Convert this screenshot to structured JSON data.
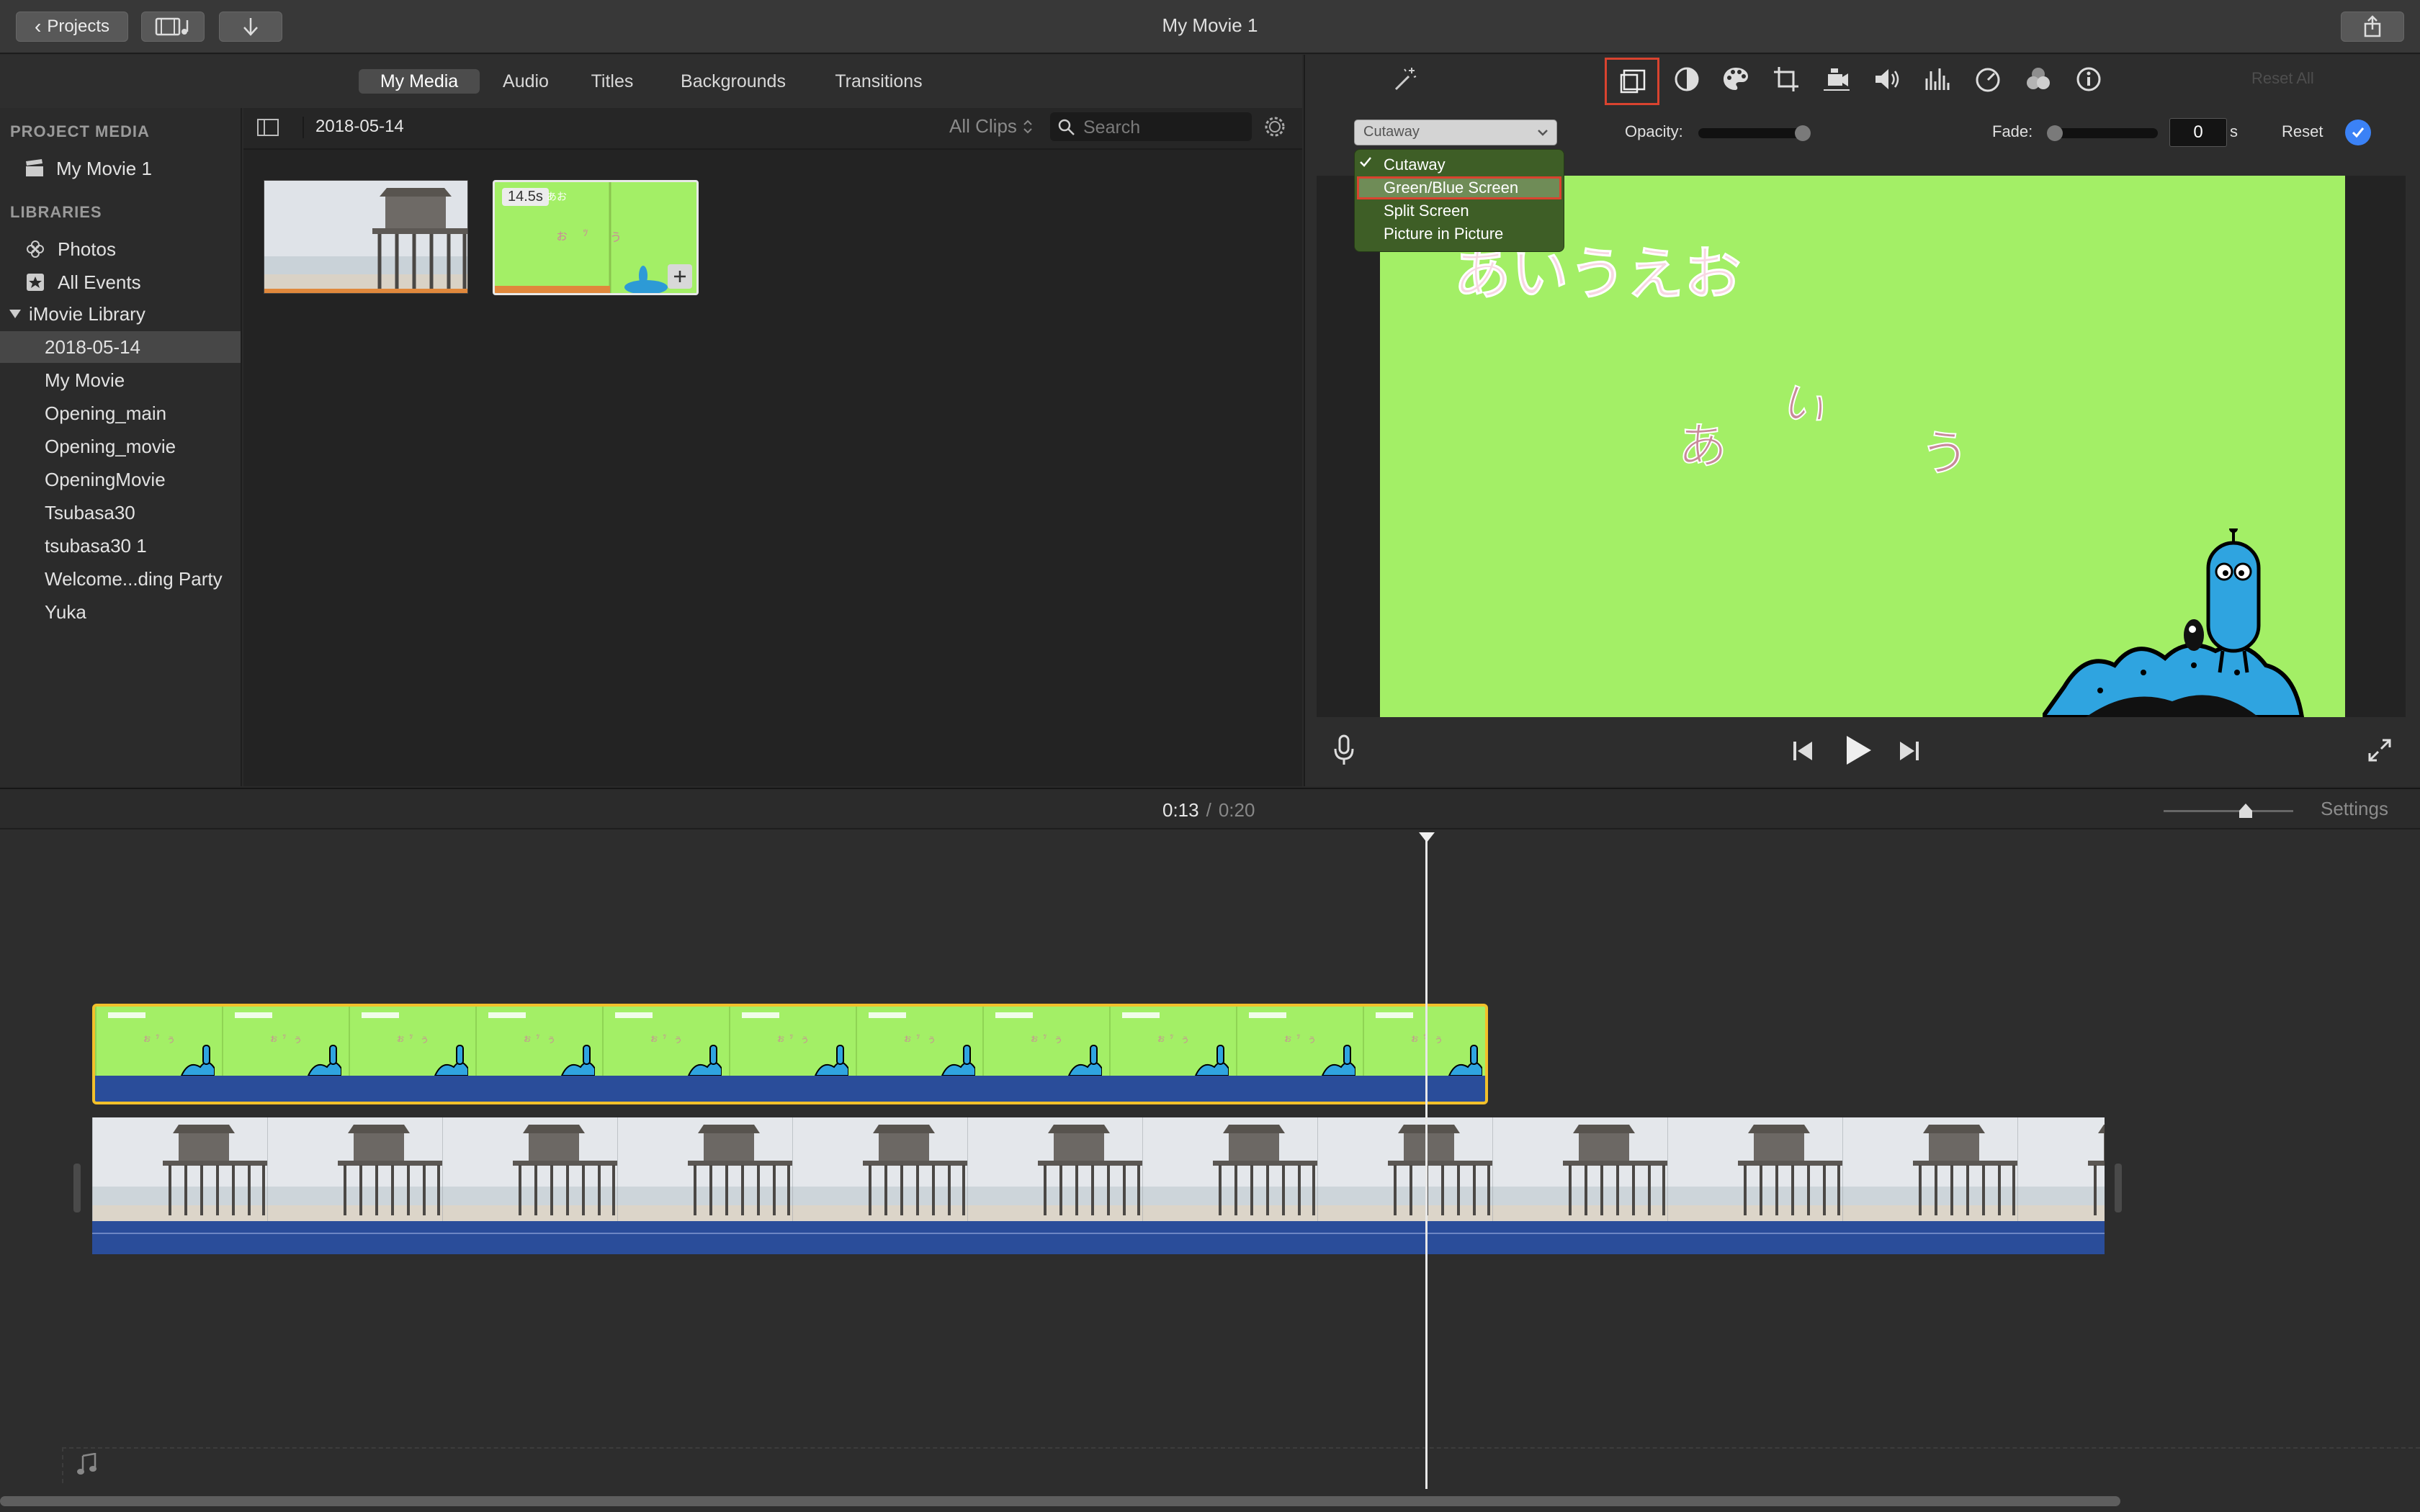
{
  "toolbar": {
    "projects_label": "Projects",
    "window_title": "My Movie 1"
  },
  "tabs": [
    {
      "label": "My Media"
    },
    {
      "label": "Audio"
    },
    {
      "label": "Titles"
    },
    {
      "label": "Backgrounds"
    },
    {
      "label": "Transitions"
    }
  ],
  "sidebar": {
    "project_media_heading": "PROJECT MEDIA",
    "project_item": "My Movie 1",
    "libraries_heading": "LIBRARIES",
    "photos": "Photos",
    "all_events": "All Events",
    "library_name": "iMovie Library",
    "events": [
      "2018-05-14",
      "My Movie",
      "Opening_main",
      "Opening_movie",
      "OpeningMovie",
      "Tsubasa30",
      "tsubasa30 1",
      "Welcome...ding Party",
      "Yuka"
    ],
    "selected_event": "2018-05-14"
  },
  "browser": {
    "date_label": "2018-05-14",
    "filter": "All Clips",
    "search_placeholder": "Search",
    "clip_duration": "14.5s",
    "clip_text": "あお"
  },
  "inspector": {
    "overlay_select": "Cutaway",
    "opacity_label": "Opacity:",
    "fade_label": "Fade:",
    "fade_value": "0",
    "fade_unit": "s",
    "reset_label": "Reset",
    "reset_all_label": "Reset All",
    "opacity_level": 1.0,
    "fade_level": 0.0
  },
  "overlay_menu": {
    "items": [
      "Cutaway",
      "Green/Blue Screen",
      "Split Screen",
      "Picture in Picture"
    ],
    "checked": "Cutaway",
    "highlighted": "Green/Blue Screen"
  },
  "viewer": {
    "title_text": "あいうえお",
    "char_1": "あ",
    "char_2": "い",
    "char_3": "う",
    "background_color": "#a3ef66"
  },
  "timeline": {
    "current_time": "0:13",
    "separator": "/",
    "total_time": "0:20",
    "settings_label": "Settings",
    "thumb_text": "あいうえお",
    "zoom_level": 0.65
  },
  "colors": {
    "selection_red": "#d9432f",
    "clip_selected_yellow": "#f2c02b",
    "audio_blue": "#2a4d9a",
    "accent_blue": "#3b82f6",
    "menu_green": "#3e5e26"
  }
}
